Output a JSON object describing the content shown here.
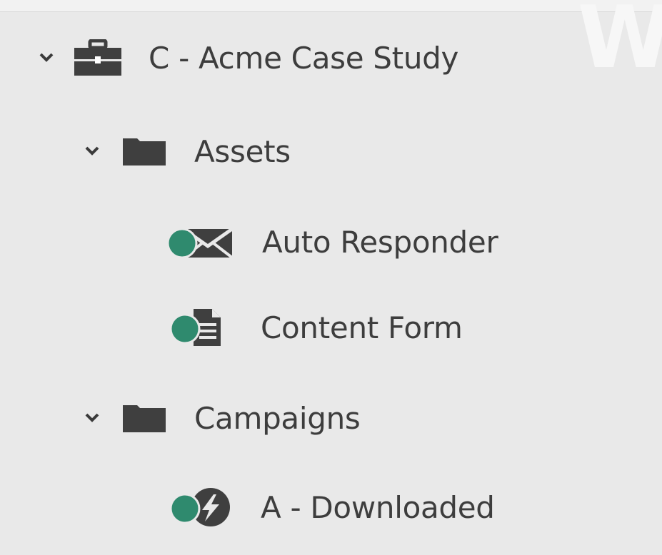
{
  "tree": {
    "root": {
      "label": "C - Acme Case Study",
      "icon": "briefcase-icon",
      "expanded": true
    },
    "folders": [
      {
        "label": "Assets",
        "icon": "folder-icon",
        "expanded": true,
        "items": [
          {
            "label": "Auto Responder",
            "icon": "email-icon",
            "status": "approved"
          },
          {
            "label": "Content Form",
            "icon": "form-icon",
            "status": "approved"
          }
        ]
      },
      {
        "label": "Campaigns",
        "icon": "folder-icon",
        "expanded": true,
        "items": [
          {
            "label": "A - Downloaded",
            "icon": "trigger-campaign-icon",
            "status": "active"
          }
        ]
      }
    ]
  },
  "colors": {
    "status_dot": "#2f8a6e",
    "icon_dark": "#3f3f3f",
    "background": "#e9e9e9",
    "text": "#3d3d3d"
  }
}
